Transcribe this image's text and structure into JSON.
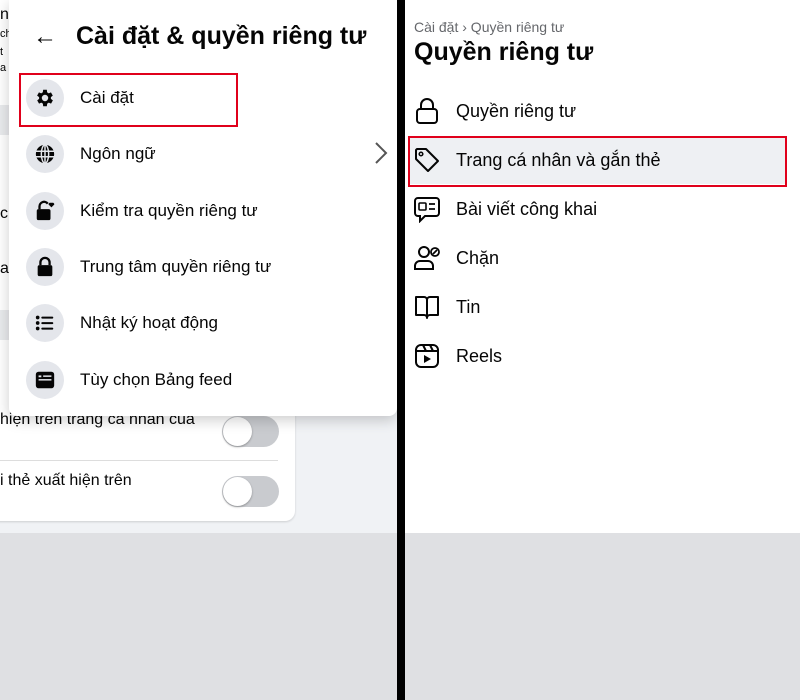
{
  "left": {
    "background_fragments": [
      "ng",
      "ch",
      "t",
      "a l",
      "củ",
      "a"
    ],
    "setting_rows": [
      {
        "label": "hiện trên trang cá nhân của",
        "enabled": false
      },
      {
        "label": "i thẻ xuất hiện trên",
        "enabled": false
      }
    ],
    "menu": {
      "title": "Cài đặt & quyền riêng tư",
      "items": [
        {
          "label": "Cài đặt",
          "icon": "gear-icon"
        },
        {
          "label": "Ngôn ngữ",
          "icon": "globe-icon"
        },
        {
          "label": "Kiểm tra quyền riêng tư",
          "icon": "lock-heart-icon"
        },
        {
          "label": "Trung tâm quyền riêng tư",
          "icon": "lock-icon"
        },
        {
          "label": "Nhật ký hoạt động",
          "icon": "list-icon"
        },
        {
          "label": "Tùy chọn Bảng feed",
          "icon": "feed-icon"
        }
      ],
      "highlighted_item": "Cài đặt"
    }
  },
  "right": {
    "breadcrumb": "Cài đặt › Quyền riêng tư",
    "title": "Quyền riêng tư",
    "items": [
      {
        "label": "Quyền riêng tư",
        "icon": "lock-outline-icon"
      },
      {
        "label": "Trang cá nhân và gắn thẻ",
        "icon": "tag-icon"
      },
      {
        "label": "Bài viết công khai",
        "icon": "public-post-icon"
      },
      {
        "label": "Chặn",
        "icon": "block-user-icon"
      },
      {
        "label": "Tin",
        "icon": "book-icon"
      },
      {
        "label": "Reels",
        "icon": "reels-icon"
      }
    ],
    "highlighted_item": "Trang cá nhân và gắn thẻ"
  },
  "colors": {
    "highlight_border": "#e0001b",
    "selected_bg": "#eef0f3",
    "icon_circle": "#e4e6eb"
  }
}
